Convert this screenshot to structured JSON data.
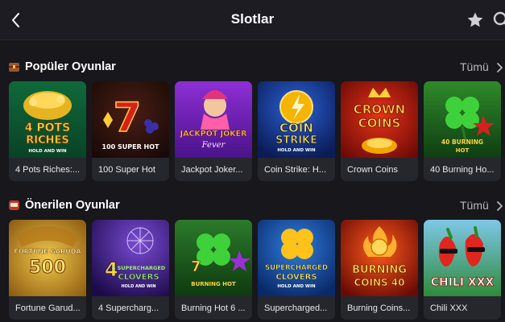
{
  "header": {
    "title": "Slotlar",
    "back_icon": "chevron-left-icon",
    "favorite_icon": "star-icon",
    "search_icon": "search-icon"
  },
  "sections": [
    {
      "title": "Popüler Oyunlar",
      "icon": "treasure-chest-icon",
      "all_label": "Tümü",
      "games": [
        {
          "name": "4 Pots Riches:...",
          "art_text": [
            "4 POTS",
            "RICHES",
            "HOLD AND WIN"
          ]
        },
        {
          "name": "100 Super Hot",
          "art_text": [
            "100 SUPER HOT"
          ]
        },
        {
          "name": "Jackpot Joker...",
          "art_text": [
            "JACKPOT JOKER",
            "Fever"
          ]
        },
        {
          "name": "Coin Strike: H...",
          "art_text": [
            "COIN",
            "STRIKE",
            "HOLD AND WIN"
          ]
        },
        {
          "name": "Crown Coins",
          "art_text": [
            "CROWN",
            "COINS"
          ]
        },
        {
          "name": "40 Burning Ho...",
          "art_text": [
            "40 BURNING",
            "HOT"
          ]
        }
      ]
    },
    {
      "title": "Önerilen Oyunlar",
      "icon": "slot-machine-icon",
      "all_label": "Tümü",
      "games": [
        {
          "name": "Fortune Garud...",
          "art_text": [
            "FORTUNE GARUDA",
            "500"
          ]
        },
        {
          "name": "4 Supercharg...",
          "art_text": [
            "4 SUPERCHARGED",
            "CLOVERS",
            "HOLD AND WIN"
          ]
        },
        {
          "name": "Burning Hot 6 ...",
          "art_text": [
            "BURNING HOT"
          ]
        },
        {
          "name": "Supercharged...",
          "art_text": [
            "SUPERCHARGED",
            "CLOVERS",
            "HOLD AND WIN"
          ]
        },
        {
          "name": "Burning Coins...",
          "art_text": [
            "BURNING",
            "COINS 40"
          ]
        },
        {
          "name": "Chili XXX",
          "art_text": [
            "CHILI XXX"
          ]
        }
      ]
    }
  ],
  "colors": {
    "background": "#17171c",
    "card": "#26262d",
    "muted_text": "#b8b8c0"
  }
}
